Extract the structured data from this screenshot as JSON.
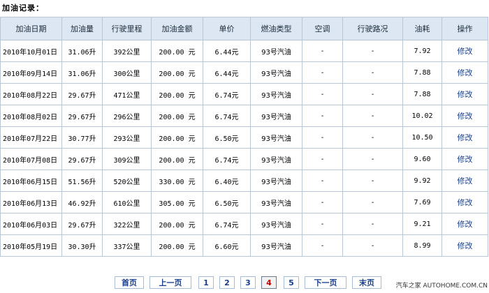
{
  "section": {
    "title": "加油记录："
  },
  "table": {
    "headers": [
      "加油日期",
      "加油量",
      "行驶里程",
      "加油金额",
      "单价",
      "燃油类型",
      "空调",
      "行驶路况",
      "油耗",
      "操作"
    ],
    "rows": [
      [
        "2010年10月01日",
        "31.06升",
        "392公里",
        "200.00 元",
        "6.44元",
        "93号汽油",
        "-",
        "-",
        "7.92",
        "修改"
      ],
      [
        "2010年09月14日",
        "31.06升",
        "300公里",
        "200.00 元",
        "6.44元",
        "93号汽油",
        "-",
        "-",
        "7.88",
        "修改"
      ],
      [
        "2010年08月22日",
        "29.67升",
        "471公里",
        "200.00 元",
        "6.74元",
        "93号汽油",
        "-",
        "-",
        "7.88",
        "修改"
      ],
      [
        "2010年08月02日",
        "29.67升",
        "296公里",
        "200.00 元",
        "6.74元",
        "93号汽油",
        "-",
        "-",
        "10.02",
        "修改"
      ],
      [
        "2010年07月22日",
        "30.77升",
        "293公里",
        "200.00 元",
        "6.50元",
        "93号汽油",
        "-",
        "-",
        "10.50",
        "修改"
      ],
      [
        "2010年07月08日",
        "29.67升",
        "309公里",
        "200.00 元",
        "6.74元",
        "93号汽油",
        "-",
        "-",
        "9.60",
        "修改"
      ],
      [
        "2010年06月15日",
        "51.56升",
        "520公里",
        "330.00 元",
        "6.40元",
        "93号汽油",
        "-",
        "-",
        "9.92",
        "修改"
      ],
      [
        "2010年06月13日",
        "46.92升",
        "610公里",
        "305.00 元",
        "6.50元",
        "93号汽油",
        "-",
        "-",
        "7.69",
        "修改"
      ],
      [
        "2010年06月03日",
        "29.67升",
        "322公里",
        "200.00 元",
        "6.74元",
        "93号汽油",
        "-",
        "-",
        "9.21",
        "修改"
      ],
      [
        "2010年05月19日",
        "30.30升",
        "337公里",
        "200.00 元",
        "6.60元",
        "93号汽油",
        "-",
        "-",
        "8.99",
        "修改"
      ]
    ]
  },
  "pager": {
    "first": "首页",
    "prev": "上一页",
    "pages": [
      "1",
      "2",
      "3",
      "4",
      "5"
    ],
    "current": "4",
    "next": "下一页",
    "last": "末页"
  },
  "watermark": "汽车之家 AUTOHOME.COM.CN",
  "colors": {
    "header_bg": "#dde7f3",
    "border": "#b9c6d6",
    "link": "#1a3f8a",
    "current_page": "#c00000"
  }
}
